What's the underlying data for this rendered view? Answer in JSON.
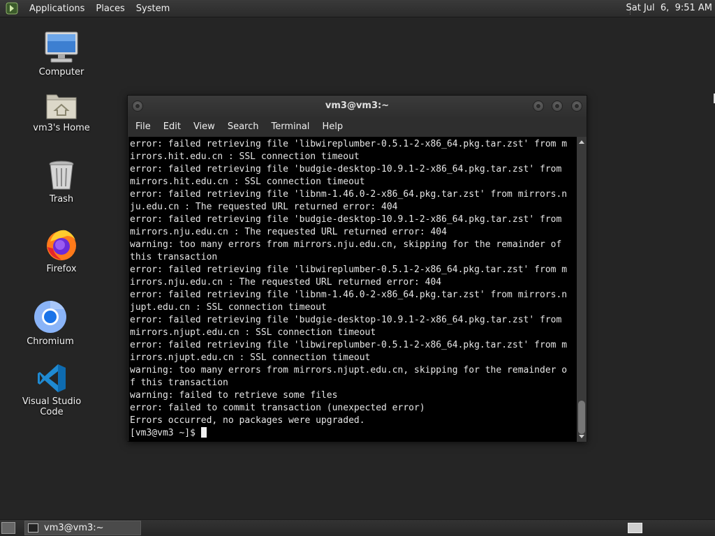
{
  "top_panel": {
    "menus": [
      "Applications",
      "Places",
      "System"
    ],
    "clock": "Sat Jul  6,  9:51 AM"
  },
  "desktop_icons": [
    {
      "label": "Computer",
      "icon": "computer-icon"
    },
    {
      "label": "vm3's Home",
      "icon": "home-folder-icon"
    },
    {
      "label": "Trash",
      "icon": "trash-icon"
    },
    {
      "label": "Firefox",
      "icon": "firefox-icon"
    },
    {
      "label": "Chromium",
      "icon": "chromium-icon"
    },
    {
      "label": "Visual Studio Code",
      "icon": "vscode-icon"
    }
  ],
  "window": {
    "title": "vm3@vm3:~",
    "menus": [
      "File",
      "Edit",
      "View",
      "Search",
      "Terminal",
      "Help"
    ]
  },
  "terminal": {
    "lines": [
      "error: failed retrieving file 'libwireplumber-0.5.1-2-x86_64.pkg.tar.zst' from m",
      "irrors.hit.edu.cn : SSL connection timeout",
      "error: failed retrieving file 'budgie-desktop-10.9.1-2-x86_64.pkg.tar.zst' from",
      "mirrors.hit.edu.cn : SSL connection timeout",
      "error: failed retrieving file 'libnm-1.46.0-2-x86_64.pkg.tar.zst' from mirrors.n",
      "ju.edu.cn : The requested URL returned error: 404",
      "error: failed retrieving file 'budgie-desktop-10.9.1-2-x86_64.pkg.tar.zst' from",
      "mirrors.nju.edu.cn : The requested URL returned error: 404",
      "warning: too many errors from mirrors.nju.edu.cn, skipping for the remainder of",
      "this transaction",
      "error: failed retrieving file 'libwireplumber-0.5.1-2-x86_64.pkg.tar.zst' from m",
      "irrors.nju.edu.cn : The requested URL returned error: 404",
      "error: failed retrieving file 'libnm-1.46.0-2-x86_64.pkg.tar.zst' from mirrors.n",
      "jupt.edu.cn : SSL connection timeout",
      "error: failed retrieving file 'budgie-desktop-10.9.1-2-x86_64.pkg.tar.zst' from",
      "mirrors.njupt.edu.cn : SSL connection timeout",
      "error: failed retrieving file 'libwireplumber-0.5.1-2-x86_64.pkg.tar.zst' from m",
      "irrors.njupt.edu.cn : SSL connection timeout",
      "warning: too many errors from mirrors.njupt.edu.cn, skipping for the remainder o",
      "f this transaction",
      "warning: failed to retrieve some files",
      "error: failed to commit transaction (unexpected error)",
      "Errors occurred, no packages were upgraded."
    ],
    "prompt": "[vm3@vm3 ~]$ "
  },
  "taskbar": {
    "task_label": "vm3@vm3:~"
  }
}
